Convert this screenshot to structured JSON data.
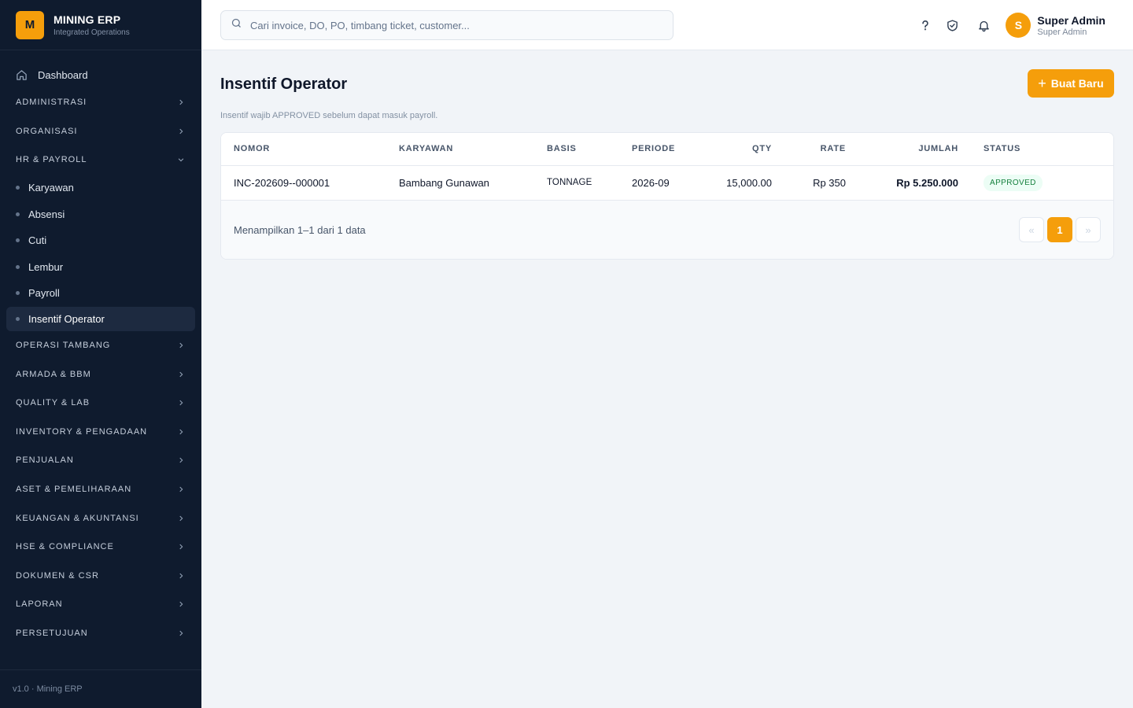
{
  "brand": {
    "logo_letter": "M",
    "name": "MINING ERP",
    "subtitle": "Integrated Operations"
  },
  "sidebar": {
    "dashboard": {
      "label": "Dashboard",
      "icon": "home-icon"
    },
    "groups_top": [
      {
        "label": "ADMINISTRASI",
        "state": "collapsed"
      },
      {
        "label": "ORGANISASI",
        "state": "collapsed"
      },
      {
        "label": "HR & PAYROLL",
        "state": "expanded"
      }
    ],
    "hr_items": [
      {
        "label": "Karyawan"
      },
      {
        "label": "Absensi"
      },
      {
        "label": "Cuti"
      },
      {
        "label": "Lembur"
      },
      {
        "label": "Payroll"
      },
      {
        "label": "Insentif Operator",
        "active": true
      }
    ],
    "groups_bottom": [
      {
        "label": "OPERASI TAMBANG"
      },
      {
        "label": "ARMADA & BBM"
      },
      {
        "label": "QUALITY & LAB"
      },
      {
        "label": "INVENTORY & PENGADAAN"
      },
      {
        "label": "PENJUALAN"
      },
      {
        "label": "ASET & PEMELIHARAAN"
      },
      {
        "label": "KEUANGAN & AKUNTANSI"
      },
      {
        "label": "HSE & COMPLIANCE"
      },
      {
        "label": "DOKUMEN & CSR"
      },
      {
        "label": "LAPORAN"
      },
      {
        "label": "PERSETUJUAN"
      }
    ],
    "footer": "v1.0 · Mining ERP"
  },
  "topbar": {
    "search_placeholder": "Cari invoice, DO, PO, timbang ticket, customer...",
    "icons": [
      "help-icon",
      "shield-check-icon",
      "bell-icon"
    ],
    "user": {
      "initial": "S",
      "name": "Super Admin",
      "role": "Super Admin"
    }
  },
  "page": {
    "title": "Insentif Operator",
    "new_button": "Buat Baru",
    "note": "Insentif wajib APPROVED sebelum dapat masuk payroll."
  },
  "table": {
    "columns": [
      "NOMOR",
      "KARYAWAN",
      "BASIS",
      "PERIODE",
      "QTY",
      "RATE",
      "JUMLAH",
      "STATUS"
    ],
    "rows": [
      {
        "nomor": "INC-202609--000001",
        "karyawan": "Bambang Gunawan",
        "basis": "TONNAGE",
        "periode": "2026-09",
        "qty": "15,000.00",
        "rate": "Rp 350",
        "jumlah": "Rp 5.250.000",
        "status": "APPROVED"
      }
    ],
    "footer_text": "Menampilkan 1–1 dari 1 data",
    "pager": {
      "prev": "«",
      "current": "1",
      "next": "»"
    }
  },
  "colors": {
    "sidebar_bg": "#0f1b2e",
    "accent": "#f59e0b",
    "approved_badge": "#15803d"
  }
}
